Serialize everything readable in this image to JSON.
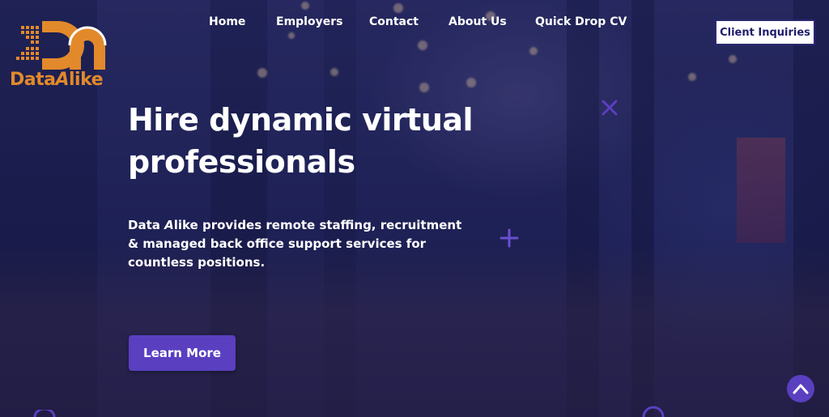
{
  "brand": {
    "logo_text_main": "Data",
    "logo_text_accent": "A",
    "logo_text_end": "like",
    "logo_color": "#e2892b",
    "logo_icon": "data-alike-logo-mark"
  },
  "nav": {
    "items": [
      {
        "label": "Home"
      },
      {
        "label": "Employers"
      },
      {
        "label": "Contact"
      },
      {
        "label": "About Us"
      },
      {
        "label": "Quick Drop CV"
      }
    ],
    "client_button_label": "Client Inquiries"
  },
  "hero": {
    "headline_line1": "Hire dynamic virtual",
    "headline_line2": "professionals",
    "subtext_pre": "Data ",
    "subtext_italic": "A",
    "subtext_post": "like provides remote staffing, recruitment & managed back office support services for countless positions.",
    "cta_label": "Learn More"
  },
  "colors": {
    "accent": "#5a3fc0",
    "button_border": "#2b2870",
    "overlay": "#1f2152"
  },
  "icons": {
    "scroll_top": "chevron-up-icon",
    "decor_x": "x-decor-icon",
    "decor_plus": "plus-decor-icon"
  }
}
